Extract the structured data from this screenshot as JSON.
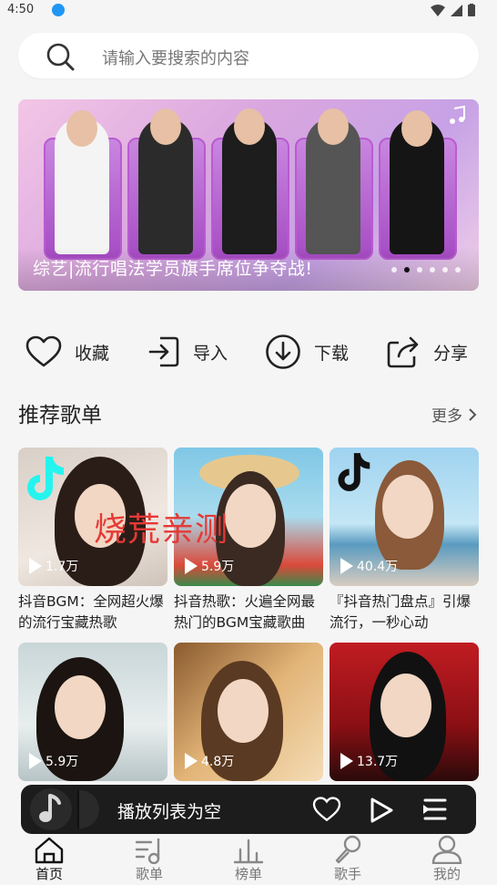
{
  "status_bar": {
    "time": "4:50"
  },
  "search": {
    "placeholder": "请输入要搜索的内容"
  },
  "banner": {
    "caption": "综艺|流行唱法学员旗手席位争夺战!",
    "active_dot": 1,
    "dot_count": 6
  },
  "actions": [
    {
      "label": "收藏",
      "icon": "heart-icon"
    },
    {
      "label": "导入",
      "icon": "import-icon"
    },
    {
      "label": "下载",
      "icon": "download-icon"
    },
    {
      "label": "分享",
      "icon": "share-icon"
    }
  ],
  "recommended": {
    "title": "推荐歌单",
    "more_label": "更多",
    "playlists": [
      {
        "plays": "1.7万",
        "title": "抖音BGM：全网超火爆的流行宝藏热歌"
      },
      {
        "plays": "5.9万",
        "title": "抖音热歌：火遍全网最热门的BGM宝藏歌曲"
      },
      {
        "plays": "40.4万",
        "title": "『抖音热门盘点』引爆流行，一秒心动"
      },
      {
        "plays": "5.9万",
        "title": ""
      },
      {
        "plays": "4.8万",
        "title": ""
      },
      {
        "plays": "13.7万",
        "title": ""
      }
    ]
  },
  "watermark": "烧荒亲测",
  "player": {
    "status": "播放列表为空"
  },
  "tabs": [
    {
      "label": "首页",
      "icon": "home-icon",
      "active": true
    },
    {
      "label": "歌单",
      "icon": "playlist-icon",
      "active": false
    },
    {
      "label": "榜单",
      "icon": "chart-icon",
      "active": false
    },
    {
      "label": "歌手",
      "icon": "microphone-icon",
      "active": false
    },
    {
      "label": "我的",
      "icon": "user-icon",
      "active": false
    }
  ]
}
